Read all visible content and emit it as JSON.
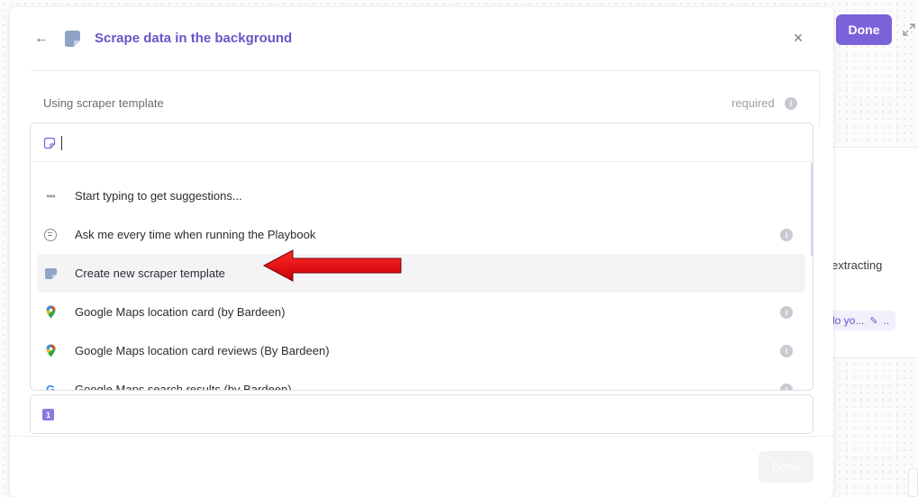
{
  "modal": {
    "title": "Scrape data in the background",
    "field_label": "Using scraper template",
    "required_label": "required",
    "search": {
      "value": "",
      "placeholder": ""
    },
    "options": [
      {
        "label": "Start typing to get suggestions...",
        "icon": "dots-icon",
        "info": false
      },
      {
        "label": "Ask me every time when running the Playbook",
        "icon": "chat-icon",
        "info": true
      },
      {
        "label": "Create new scraper template",
        "icon": "scraper-template-icon",
        "info": false,
        "highlighted": true
      },
      {
        "label": "Google Maps location card (by Bardeen)",
        "icon": "google-maps-pin-icon",
        "info": true
      },
      {
        "label": "Google Maps location card reviews (By Bardeen)",
        "icon": "google-maps-pin-icon",
        "info": true
      },
      {
        "label": "Google Maps search results (by Bardeen)",
        "icon": "google-g-icon",
        "info": true
      }
    ],
    "second_field_badge": "1",
    "footer_done_label": "Done"
  },
  "background": {
    "done_label": "Done",
    "card_text": "extracting",
    "chip_text": "lo yo...",
    "chip_trailing": ".."
  },
  "colors": {
    "accent": "#7b62d9",
    "title": "#6a55c8",
    "arrow_red": "#e8000b"
  }
}
